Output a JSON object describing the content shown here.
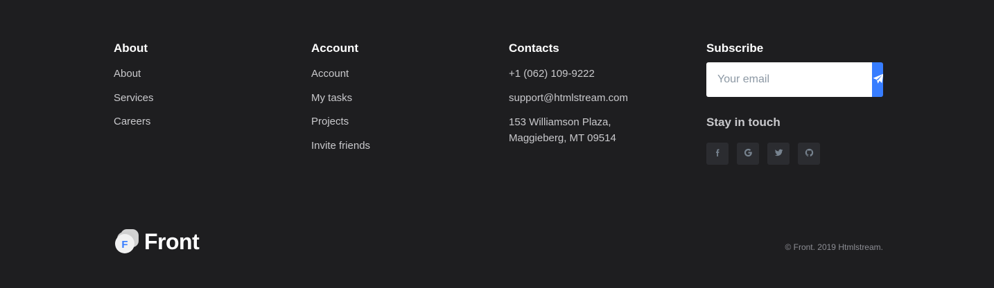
{
  "columns": {
    "about": {
      "title": "About",
      "links": [
        "About",
        "Services",
        "Careers"
      ]
    },
    "account": {
      "title": "Account",
      "links": [
        "Account",
        "My tasks",
        "Projects",
        "Invite friends"
      ]
    },
    "contacts": {
      "title": "Contacts",
      "phone": "+1 (062) 109-9222",
      "email": "support@htmlstream.com",
      "address_line1": "153 Williamson Plaza,",
      "address_line2": "Maggieberg, MT 09514"
    },
    "subscribe": {
      "title": "Subscribe",
      "email_placeholder": "Your email",
      "email_value": "",
      "send_icon": "paper-plane-icon",
      "stay_title": "Stay in touch",
      "social": [
        {
          "icon": "facebook-icon",
          "glyph": "f"
        },
        {
          "icon": "google-icon",
          "glyph": "G"
        },
        {
          "icon": "twitter-icon",
          "glyph": "t"
        },
        {
          "icon": "github-icon",
          "glyph": "gh"
        }
      ]
    }
  },
  "brand": {
    "name": "Front",
    "mark_letter": "F"
  },
  "copyright": "© Front. 2019 Htmlstream.",
  "colors": {
    "background": "#1e1e20",
    "accent": "#377dff",
    "social_bg": "#2b2c30"
  }
}
